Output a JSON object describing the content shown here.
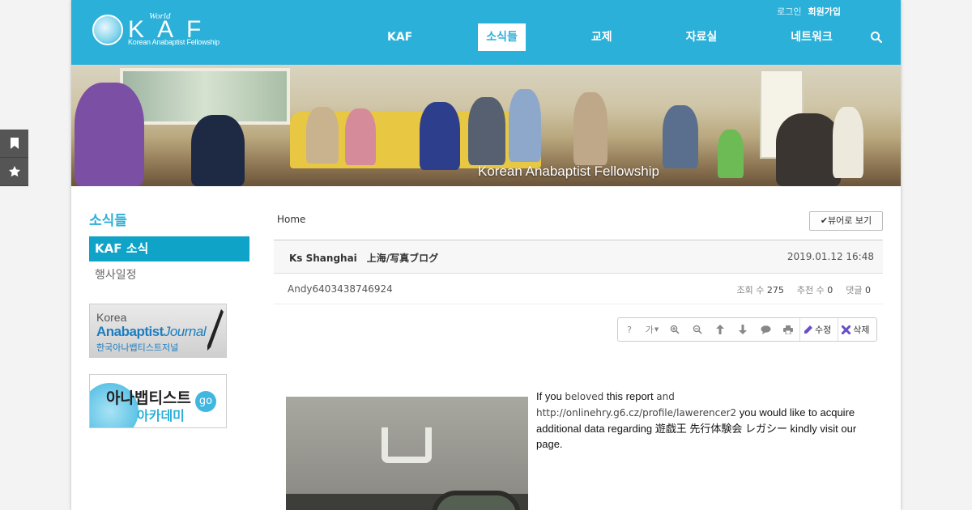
{
  "side_tools": {
    "icons": [
      "bookmark-icon",
      "star-icon"
    ]
  },
  "header": {
    "logo": {
      "world": "World",
      "kaf": "KAF",
      "sub": "Korean Anabaptist Fellowship"
    },
    "toplinks": {
      "login": "로그인",
      "join": "회원가입"
    },
    "nav": [
      {
        "label": "KAF",
        "active": false
      },
      {
        "label": "소식들",
        "active": true
      },
      {
        "label": "교제",
        "active": false
      },
      {
        "label": "자료실",
        "active": false
      },
      {
        "label": "네트워크",
        "active": false
      }
    ],
    "search_icon": "search-icon",
    "brand_color": "#2bb0d9"
  },
  "banner": {
    "caption": "Korean Anabaptist Fellowship"
  },
  "sidebar": {
    "title": "소식들",
    "items": [
      {
        "label": "KAF 소식",
        "active": true
      },
      {
        "label": "행사일정",
        "active": false
      }
    ],
    "ad1": {
      "line1": "Korea",
      "line2a": "Anabaptist",
      "line2b": "Journal",
      "line3": "한국아나뱁티스트저널"
    },
    "ad2": {
      "line1": "아나뱁티스트",
      "line2": "아카데미",
      "go": "go"
    }
  },
  "content": {
    "breadcrumb": "Home",
    "viewer_button": "✔뷰어로 보기",
    "post": {
      "title": "Ks Shanghai　上海/写真ブログ",
      "date": "2019.01.12 16:48",
      "author": "Andy6403438746924",
      "views_label": "조회 수",
      "views": "275",
      "recommend_label": "추천 수",
      "recommend": "0",
      "comments_label": "댓글",
      "comments": "0"
    },
    "toolbar": {
      "help": "?",
      "font": "가",
      "edit": "수정",
      "delete": "삭제"
    },
    "body": {
      "t1": "If you ",
      "t2": "beloved",
      "t3": " this report ",
      "t4": "and",
      "t5": "http://onlinehry.g6.cz/profile/lawerencer2",
      "t6": " you would like to acquire additional data regarding 遊戯王 先行体験会 レガシー kindly visit our page."
    }
  }
}
